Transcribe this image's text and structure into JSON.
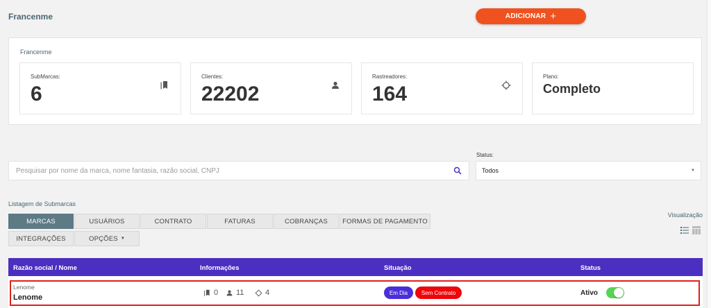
{
  "header": {
    "title": "Francenme",
    "add_label": "ADICIONAR"
  },
  "summary": {
    "title": "Francenme",
    "stats": [
      {
        "label": "SubMarcas:",
        "value": "6",
        "icon": "book-icon"
      },
      {
        "label": "Clientes:",
        "value": "22202",
        "icon": "person-icon"
      },
      {
        "label": "Rastreadores:",
        "value": "164",
        "icon": "crosshair-icon"
      },
      {
        "label": "Plano:",
        "value": "Completo"
      }
    ]
  },
  "filters": {
    "search_placeholder": "Pesquisar por nome da marca, nome fantasia, razão social, CNPJ",
    "status_label": "Status:",
    "status_value": "Todos"
  },
  "list": {
    "title": "Listagem de Submarcas",
    "visualization_label": "Visualização",
    "tabs": [
      "MARCAS",
      "USUÁRIOS",
      "CONTRATO",
      "FATURAS",
      "COBRANÇAS",
      "FORMAS DE PAGAMENTO",
      "INTEGRAÇÕES",
      "OPÇÕES"
    ],
    "active_tab": "MARCAS"
  },
  "table": {
    "columns": [
      "Razão social / Nome",
      "Informações",
      "Situação",
      "Status"
    ],
    "rows": [
      {
        "sub": "Lenome",
        "name": "Lenome",
        "submarcas": "0",
        "clientes": "11",
        "rastreadores": "4",
        "badges": [
          "Em Dia",
          "Sem Contrato"
        ],
        "status": "Ativo",
        "active": true
      }
    ]
  },
  "colors": {
    "accent": "#f0521f",
    "table_header": "#4a2fc0",
    "active_tab": "#5d7a85",
    "badge_blue": "#4a2fd8",
    "badge_red": "#f0050a",
    "toggle": "#57d357"
  }
}
